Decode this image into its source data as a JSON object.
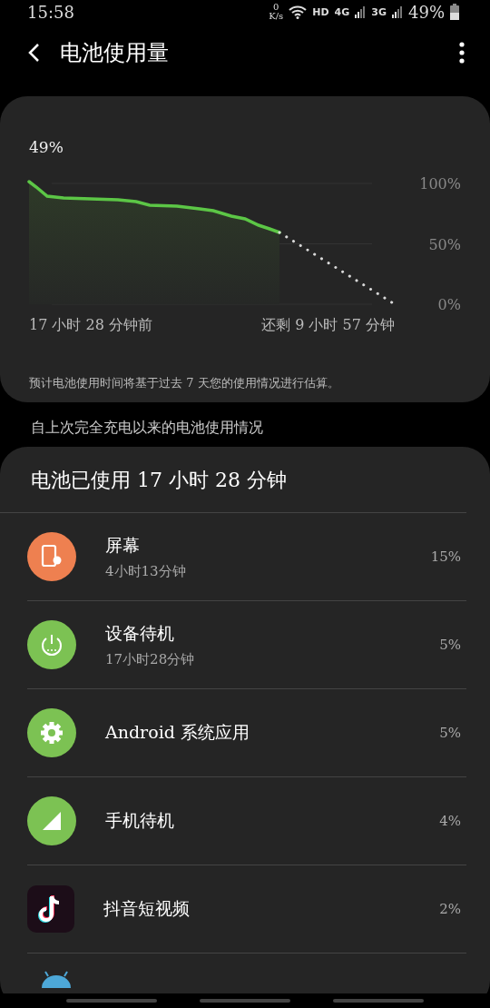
{
  "status_bar": {
    "time": "15:58",
    "speed_value": "0",
    "speed_unit": "K/s",
    "hd": "HD",
    "net_1": "4G",
    "net_2": "3G",
    "battery": "49%"
  },
  "header": {
    "title": "电池使用量"
  },
  "graph_card": {
    "current": "49%",
    "start_label": "17 小时 28 分钟前",
    "end_label": "还剩 9 小时 57 分钟",
    "note": "预计电池使用时间将基于过去 7 天您的使用情况进行估算。",
    "axis_labels": [
      "100%",
      "50%",
      "0%"
    ]
  },
  "section_title": "自上次完全充电以来的电池使用情况",
  "usage_card": {
    "title": "电池已使用 17 小时 28 分钟",
    "items": [
      {
        "kind": "screen",
        "color": "#ee8050",
        "name": "屏幕",
        "detail": "4小时13分钟",
        "percent": "15%"
      },
      {
        "kind": "power",
        "color": "#7cc253",
        "name": "设备待机",
        "detail": "17小时28分钟",
        "percent": "5%"
      },
      {
        "kind": "gear",
        "color": "#7cc253",
        "name": "Android 系统应用",
        "percent": "5%"
      },
      {
        "kind": "signal",
        "color": "#7cc253",
        "name": "手机待机",
        "percent": "4%"
      },
      {
        "kind": "app",
        "name": "抖音短视频",
        "percent": "2%"
      },
      {
        "kind": "robot"
      }
    ]
  }
}
